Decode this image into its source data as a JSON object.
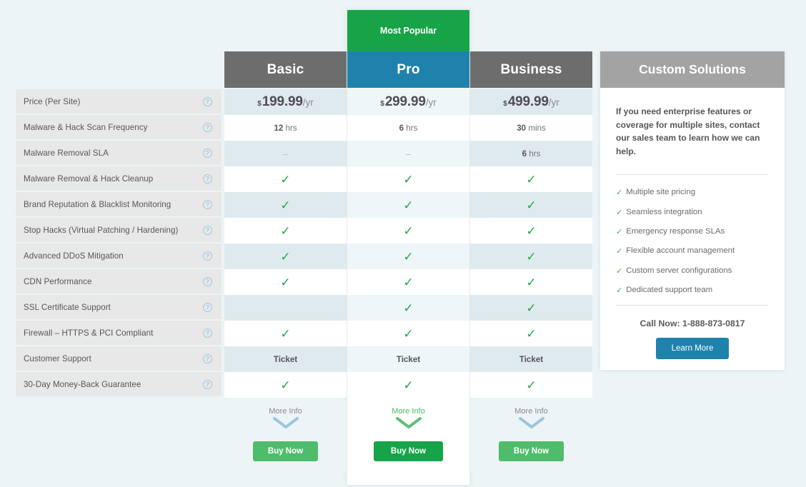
{
  "colors": {
    "page_bg": "#edf4f6",
    "header_gray": "#6d6d6d",
    "pro_teal": "#1f82ad",
    "popular_green": "#17a447",
    "buy_green": "#4fbc6b",
    "buy_green_pro": "#16a34a",
    "check_green": "#20a84a",
    "custom_header_gray": "#a3a3a3",
    "row_tint": "#dfeaee",
    "label_bg": "#e8e8e8"
  },
  "plans": [
    {
      "id": "basic",
      "name": "Basic",
      "popular": false,
      "badge": ""
    },
    {
      "id": "pro",
      "name": "Pro",
      "popular": true,
      "badge": "Most Popular"
    },
    {
      "id": "business",
      "name": "Business",
      "popular": false,
      "badge": ""
    }
  ],
  "price": {
    "currency_symbol": "$",
    "period_suffix": "/yr",
    "basic": "199.99",
    "pro": "299.99",
    "business": "499.99"
  },
  "features": [
    {
      "label": "Price (Per Site)",
      "help": "?"
    },
    {
      "label": "Malware & Hack Scan Frequency",
      "help": "?"
    },
    {
      "label": "Malware Removal SLA",
      "help": "?"
    },
    {
      "label": "Malware Removal & Hack Cleanup",
      "help": "?"
    },
    {
      "label": "Brand Reputation & Blacklist Monitoring",
      "help": "?"
    },
    {
      "label": "Stop Hacks (Virtual Patching / Hardening)",
      "help": "?"
    },
    {
      "label": "Advanced DDoS Mitigation",
      "help": "?"
    },
    {
      "label": "CDN Performance",
      "help": "?"
    },
    {
      "label": "SSL Certificate Support",
      "help": "?"
    },
    {
      "label": "Firewall – HTTPS & PCI Compliant",
      "help": "?"
    },
    {
      "label": "Customer Support",
      "help": "?"
    },
    {
      "label": "30-Day Money-Back Guarantee",
      "help": "?"
    }
  ],
  "values": {
    "basic": [
      {
        "type": "price"
      },
      {
        "type": "text",
        "num": "12",
        "unit": "hrs"
      },
      {
        "type": "dash",
        "text": "–"
      },
      {
        "type": "check",
        "text": "✓"
      },
      {
        "type": "check",
        "text": "✓"
      },
      {
        "type": "check",
        "text": "✓"
      },
      {
        "type": "check",
        "text": "✓"
      },
      {
        "type": "check",
        "text": "✓"
      },
      {
        "type": "empty",
        "text": ""
      },
      {
        "type": "check",
        "text": "✓"
      },
      {
        "type": "plain",
        "text": "Ticket"
      },
      {
        "type": "check",
        "text": "✓"
      }
    ],
    "pro": [
      {
        "type": "price"
      },
      {
        "type": "text",
        "num": "6",
        "unit": "hrs"
      },
      {
        "type": "dash",
        "text": "–"
      },
      {
        "type": "check",
        "text": "✓"
      },
      {
        "type": "check",
        "text": "✓"
      },
      {
        "type": "check",
        "text": "✓"
      },
      {
        "type": "check",
        "text": "✓"
      },
      {
        "type": "check",
        "text": "✓"
      },
      {
        "type": "check",
        "text": "✓"
      },
      {
        "type": "check",
        "text": "✓"
      },
      {
        "type": "plain",
        "text": "Ticket"
      },
      {
        "type": "check",
        "text": "✓"
      }
    ],
    "business": [
      {
        "type": "price"
      },
      {
        "type": "text",
        "num": "30",
        "unit": "mins"
      },
      {
        "type": "text",
        "num": "6",
        "unit": "hrs"
      },
      {
        "type": "check",
        "text": "✓"
      },
      {
        "type": "check",
        "text": "✓"
      },
      {
        "type": "check",
        "text": "✓"
      },
      {
        "type": "check",
        "text": "✓"
      },
      {
        "type": "check",
        "text": "✓"
      },
      {
        "type": "check",
        "text": "✓"
      },
      {
        "type": "check",
        "text": "✓"
      },
      {
        "type": "plain",
        "text": "Ticket"
      },
      {
        "type": "check",
        "text": "✓"
      }
    ]
  },
  "footer": {
    "more_info_label": "More Info",
    "chevron_icon": "chevron-down-icon",
    "buy_label": "Buy Now"
  },
  "custom": {
    "title": "Custom Solutions",
    "description": "If you need enterprise features or coverage for multiple sites, contact our sales team to learn how we can help.",
    "features": [
      "Multiple site pricing",
      "Seamless integration",
      "Emergency response SLAs",
      "Flexible account management",
      "Custom server configurations",
      "Dedicated support team"
    ],
    "tick": "✓",
    "call_now": "Call Now: 1-888-873-0817",
    "learn_more_label": "Learn More"
  }
}
